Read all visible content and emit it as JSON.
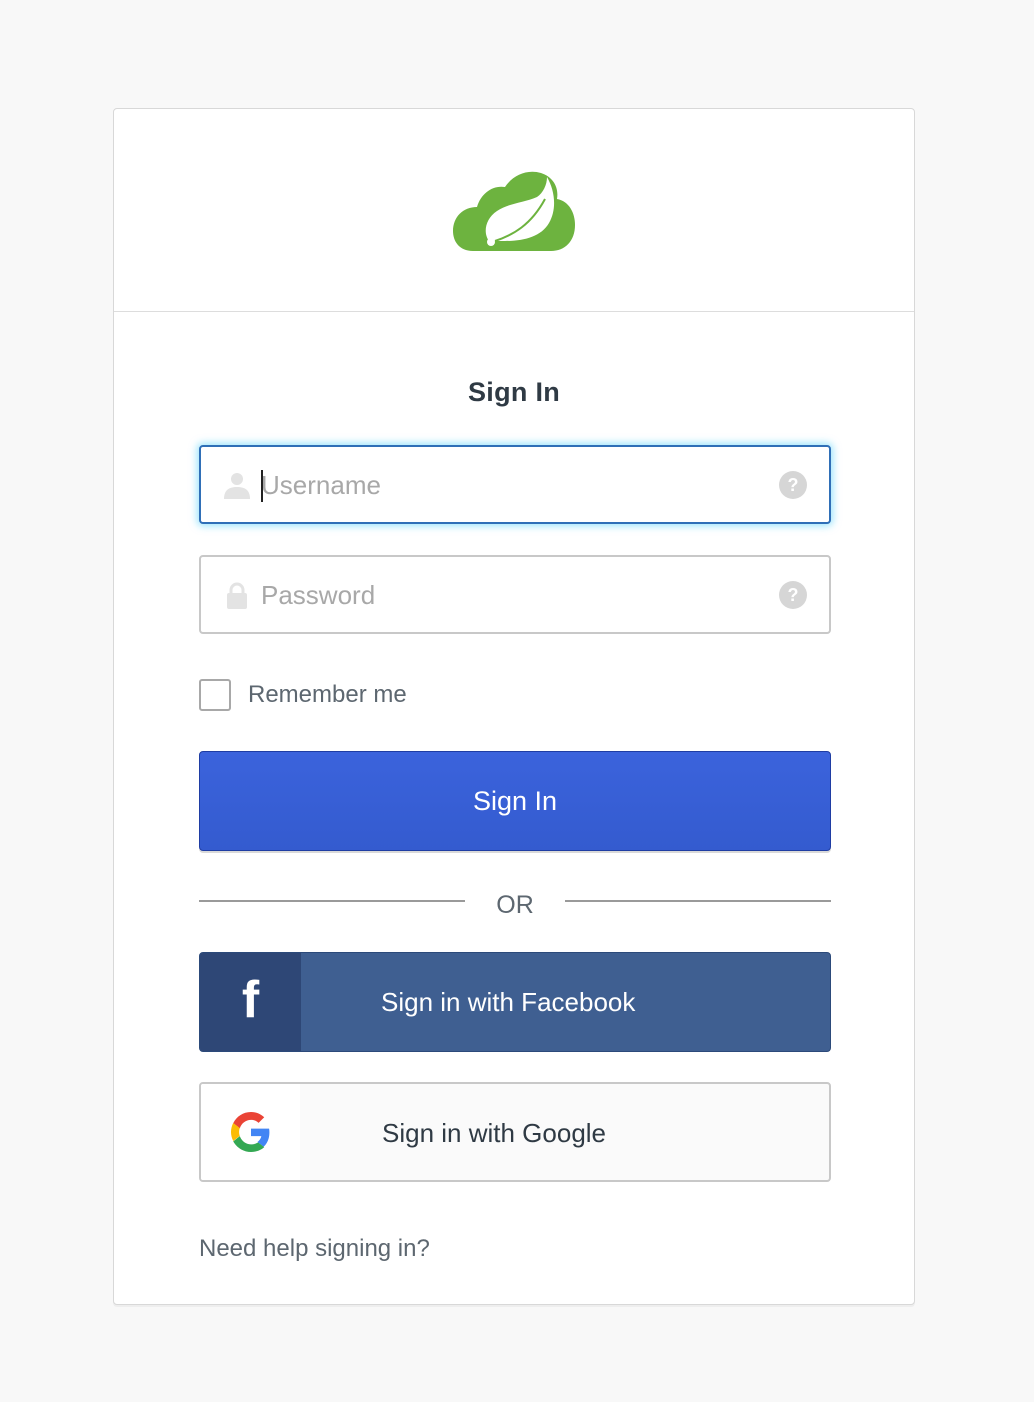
{
  "header": {
    "logo": "spring-cloud-leaf-logo",
    "logo_color": "#6db33f"
  },
  "form": {
    "title": "Sign In",
    "username": {
      "placeholder": "Username",
      "value": "",
      "icon": "user-icon",
      "help_icon": "?",
      "focused": true
    },
    "password": {
      "placeholder": "Password",
      "value": "",
      "icon": "lock-icon",
      "help_icon": "?"
    },
    "remember_me": {
      "label": "Remember me",
      "checked": false
    },
    "submit_label": "Sign In",
    "submit_color": "#3760d6",
    "divider_text": "OR",
    "social": [
      {
        "provider": "facebook",
        "label": "Sign in with Facebook",
        "icon_glyph": "f",
        "color": "#3f5f91"
      },
      {
        "provider": "google",
        "label": "Sign in with Google",
        "icon_glyph": "G"
      }
    ],
    "help_link": "Need help signing in?"
  }
}
